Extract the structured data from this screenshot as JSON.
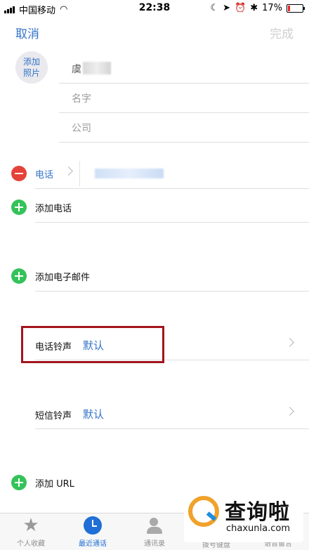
{
  "status_bar": {
    "carrier": "中国移动",
    "time": "22:38",
    "battery": "17%",
    "battery_level": 0.17
  },
  "nav": {
    "cancel": "取消",
    "done": "完成"
  },
  "photo": {
    "label_line1": "添加",
    "label_line2": "照片"
  },
  "fields": {
    "name_placeholder": "名字",
    "company_placeholder": "公司",
    "surname_partial": "虞"
  },
  "phone": {
    "label": "电话"
  },
  "rows": {
    "add_phone": "添加电话",
    "add_email": "添加电子邮件",
    "ringtone_label": "电话铃声",
    "ringtone_value": "默认",
    "text_tone_label": "短信铃声",
    "text_tone_value": "默认",
    "add_url": "添加 URL"
  },
  "tabs": [
    {
      "label": "个人收藏",
      "icon": "star-icon"
    },
    {
      "label": "最近通话",
      "icon": "clock-icon",
      "active": true
    },
    {
      "label": "通讯录",
      "icon": "contacts-icon"
    },
    {
      "label": "拨号键盘",
      "icon": "keypad-icon"
    },
    {
      "label": "语音留言",
      "icon": "voicemail-icon"
    }
  ],
  "watermark": {
    "title": "查询啦",
    "url": "chaxunla.com"
  },
  "colors": {
    "accent": "#3474c8",
    "add": "#35c25a",
    "delete": "#e5423a",
    "highlight": "#a3141d"
  }
}
